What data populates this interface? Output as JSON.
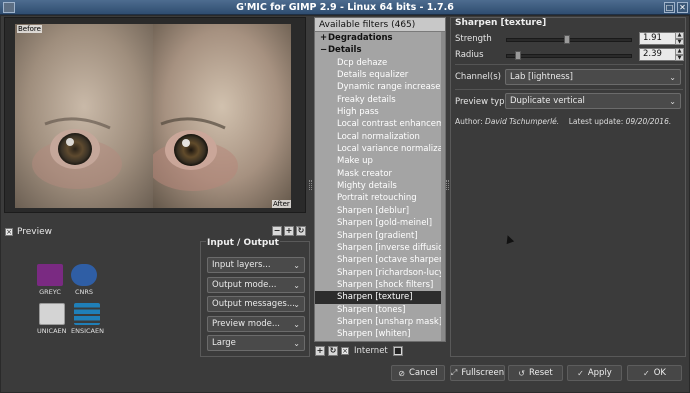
{
  "window": {
    "title": "G'MIC for GIMP 2.9 - Linux 64 bits - 1.7.6"
  },
  "preview": {
    "before_label": "Before",
    "after_label": "After",
    "checkbox_label": "Preview",
    "checked": true
  },
  "logos": [
    {
      "label": "GREYC",
      "color": "#7a2a82"
    },
    {
      "label": "CNRS",
      "color": "#2f5ea5"
    },
    {
      "label": "UNICAEN",
      "color": "#c7c7c7"
    },
    {
      "label": "ENSICAEN",
      "color": "#1f7fb8"
    }
  ],
  "io": {
    "title": "Input / Output",
    "combos": [
      "Input layers...",
      "Output mode...",
      "Output messages...",
      "Preview mode...",
      "Large"
    ]
  },
  "filters": {
    "header": "Available filters (465)",
    "categories": [
      "Degradations",
      "Details"
    ],
    "items": [
      "Dcp dehaze",
      "Details equalizer",
      "Dynamic range increase",
      "Freaky details",
      "High pass",
      "Local contrast enhancement",
      "Local normalization",
      "Local variance normalization",
      "Make up",
      "Mask creator",
      "Mighty details",
      "Portrait retouching",
      "Sharpen [deblur]",
      "Sharpen [gold-meinel]",
      "Sharpen [gradient]",
      "Sharpen [inverse diffusion]",
      "Sharpen [octave sharpening]",
      "Sharpen [richardson-lucy]",
      "Sharpen [shock filters]",
      "Sharpen [texture]",
      "Sharpen [tones]",
      "Sharpen [unsharp mask]",
      "Sharpen [whiten]"
    ],
    "selected": "Sharpen [texture]",
    "internet_label": "Internet"
  },
  "params": {
    "title": "Sharpen [texture]",
    "strength": {
      "label": "Strength",
      "value": "1.91",
      "fraction": 0.48
    },
    "radius": {
      "label": "Radius",
      "value": "2.39",
      "fraction": 0.07
    },
    "channels": {
      "label": "Channel(s)",
      "value": "Lab [lightness]"
    },
    "preview_type": {
      "label": "Preview type",
      "value": "Duplicate vertical"
    },
    "author_prefix": "Author:",
    "author_name": "David Tschumperlé.",
    "update_label": "Latest update:",
    "update_date": "09/20/2016."
  },
  "buttons": {
    "cancel": "Cancel",
    "fullscreen": "Fullscreen",
    "reset": "Reset",
    "apply": "Apply",
    "ok": "OK"
  }
}
